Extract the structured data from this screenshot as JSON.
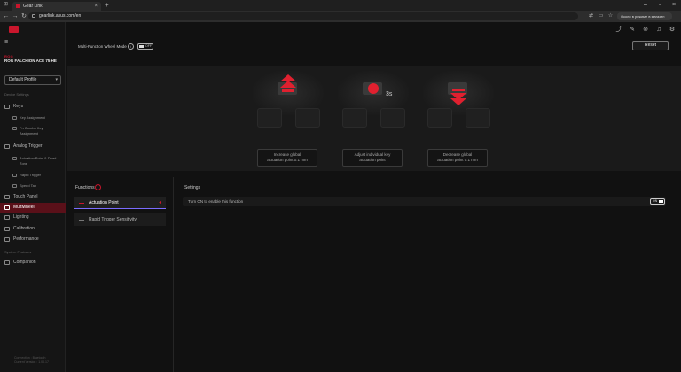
{
  "browser": {
    "tab_title": "Gear Link",
    "url": "gearlink.asus.com/en",
    "vpn_text": "Около в режиме в магазин"
  },
  "sidebar": {
    "brand": "ROG",
    "device_name": "ROG FALCHION ACE 75 HE",
    "profile": "Default Profile",
    "section_device": "Device Settings",
    "keys": "Keys",
    "key_assignment": "Key Assignment",
    "fn_combo_1": "Fn Combo Key",
    "fn_combo_2": "Assignment",
    "analog_trigger": "Analog Trigger",
    "actuation_1": "Actuation Point & Dead",
    "actuation_2": "Zone",
    "rapid_trigger": "Rapid Trigger",
    "speed_tap": "Speed Tap",
    "touch_panel": "Touch Panel",
    "multiwheel": "Multiwheel",
    "lighting": "Lighting",
    "calibration": "Calibration",
    "performance": "Performance",
    "section_system": "System Features",
    "companion": "Companion",
    "footer_1": "Connection : Bluetooth",
    "footer_2": "Current Version : 1.00.17"
  },
  "header": {
    "mode_label": "Multi-Function Wheel Mode",
    "mode_toggle": "OFF",
    "reset": "Reset"
  },
  "preview": {
    "hold_label": "3s",
    "cards": [
      {
        "line1": "Increase global",
        "line2": "actuation point 0.1 mm"
      },
      {
        "line1": "Adjust individual key",
        "line2": "actuation point"
      },
      {
        "line1": "Decrease global",
        "line2": "actuation point 0.1 mm"
      }
    ]
  },
  "functions": {
    "title": "Functions",
    "items": [
      "Actuation Point",
      "Rapid Trigger Sensitivity"
    ]
  },
  "settings": {
    "title": "Settings",
    "row_label": "Turn ON to enable this function",
    "toggle": "ON"
  },
  "colors": {
    "accent": "#c9162c",
    "active_nav": "#5a1019",
    "underline": "#7b6cff"
  }
}
